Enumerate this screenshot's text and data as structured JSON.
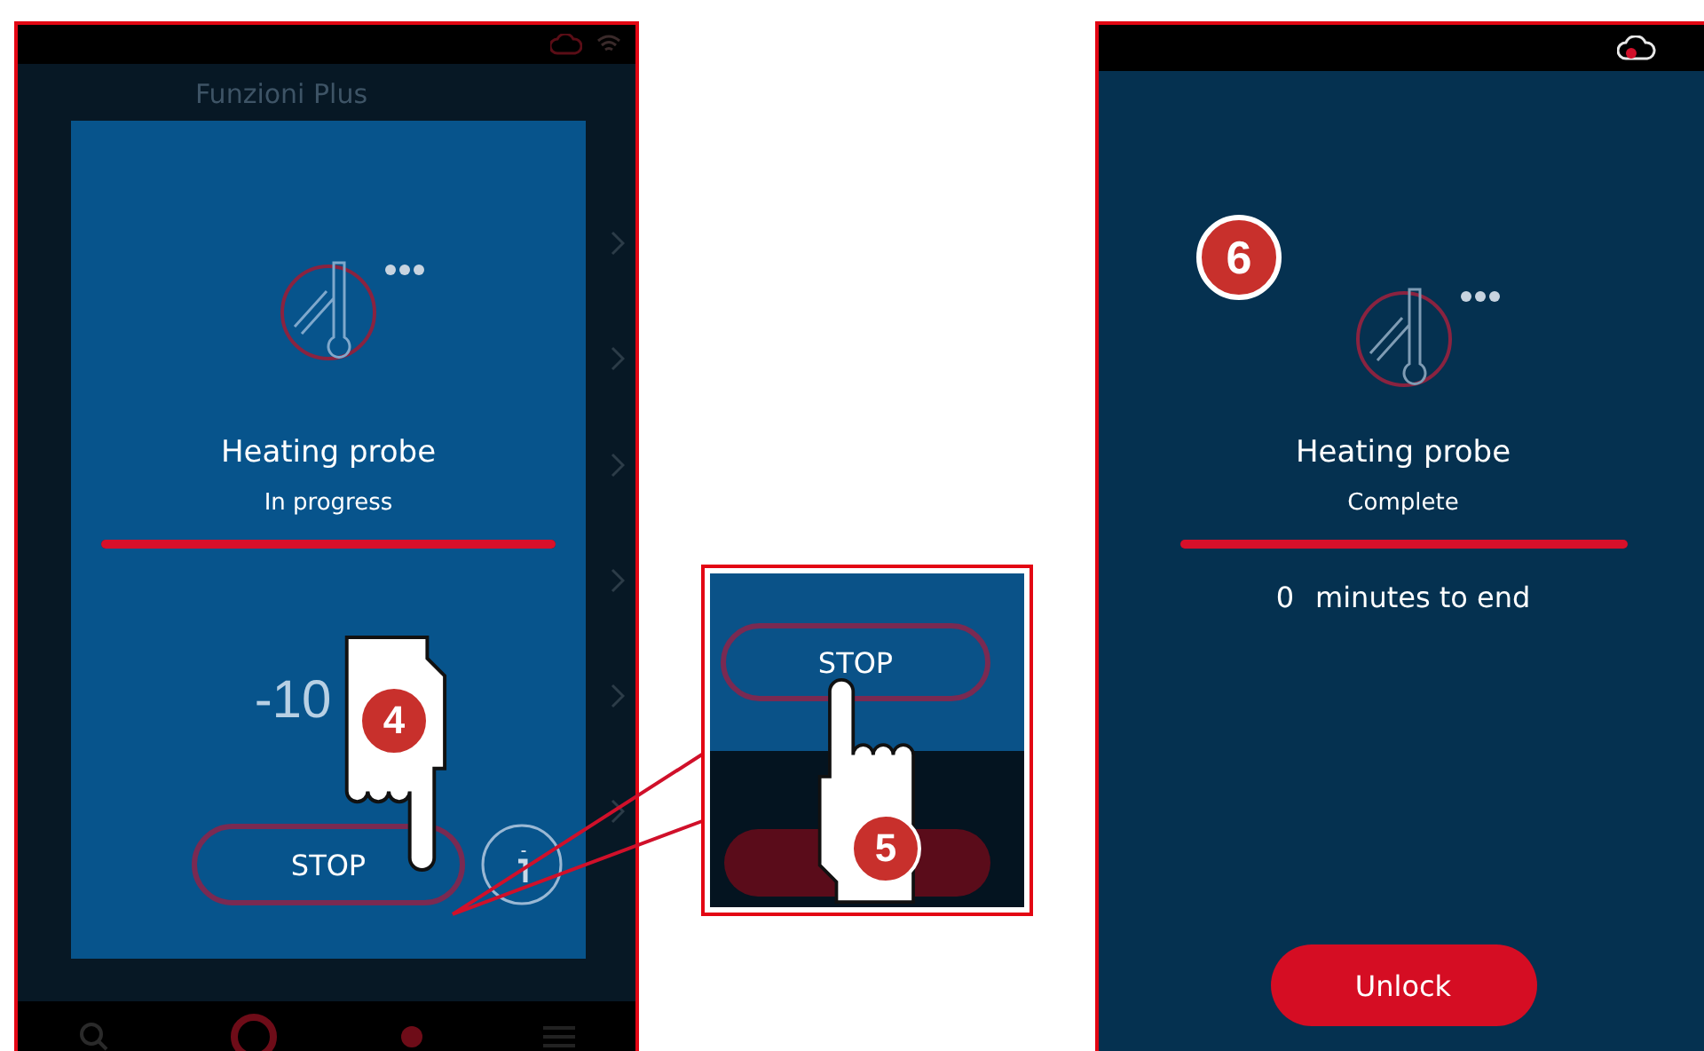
{
  "screen_left": {
    "title": "Funzioni Plus",
    "dialog": {
      "name": "Heating probe",
      "status": "In progress",
      "progress": {
        "level": 1
      },
      "temperature": "-10",
      "stop_button": "STOP"
    }
  },
  "zoom_inset": {
    "stop_button": "STOP"
  },
  "screen_right": {
    "name": "Heating probe",
    "status": "Complete",
    "progress": {
      "level": 1
    },
    "minutes": "0",
    "minutes_label": "minutes to end",
    "unlock_button": "Unlock"
  },
  "callouts": [
    {
      "number": "4"
    },
    {
      "number": "5"
    },
    {
      "number": "6"
    }
  ]
}
